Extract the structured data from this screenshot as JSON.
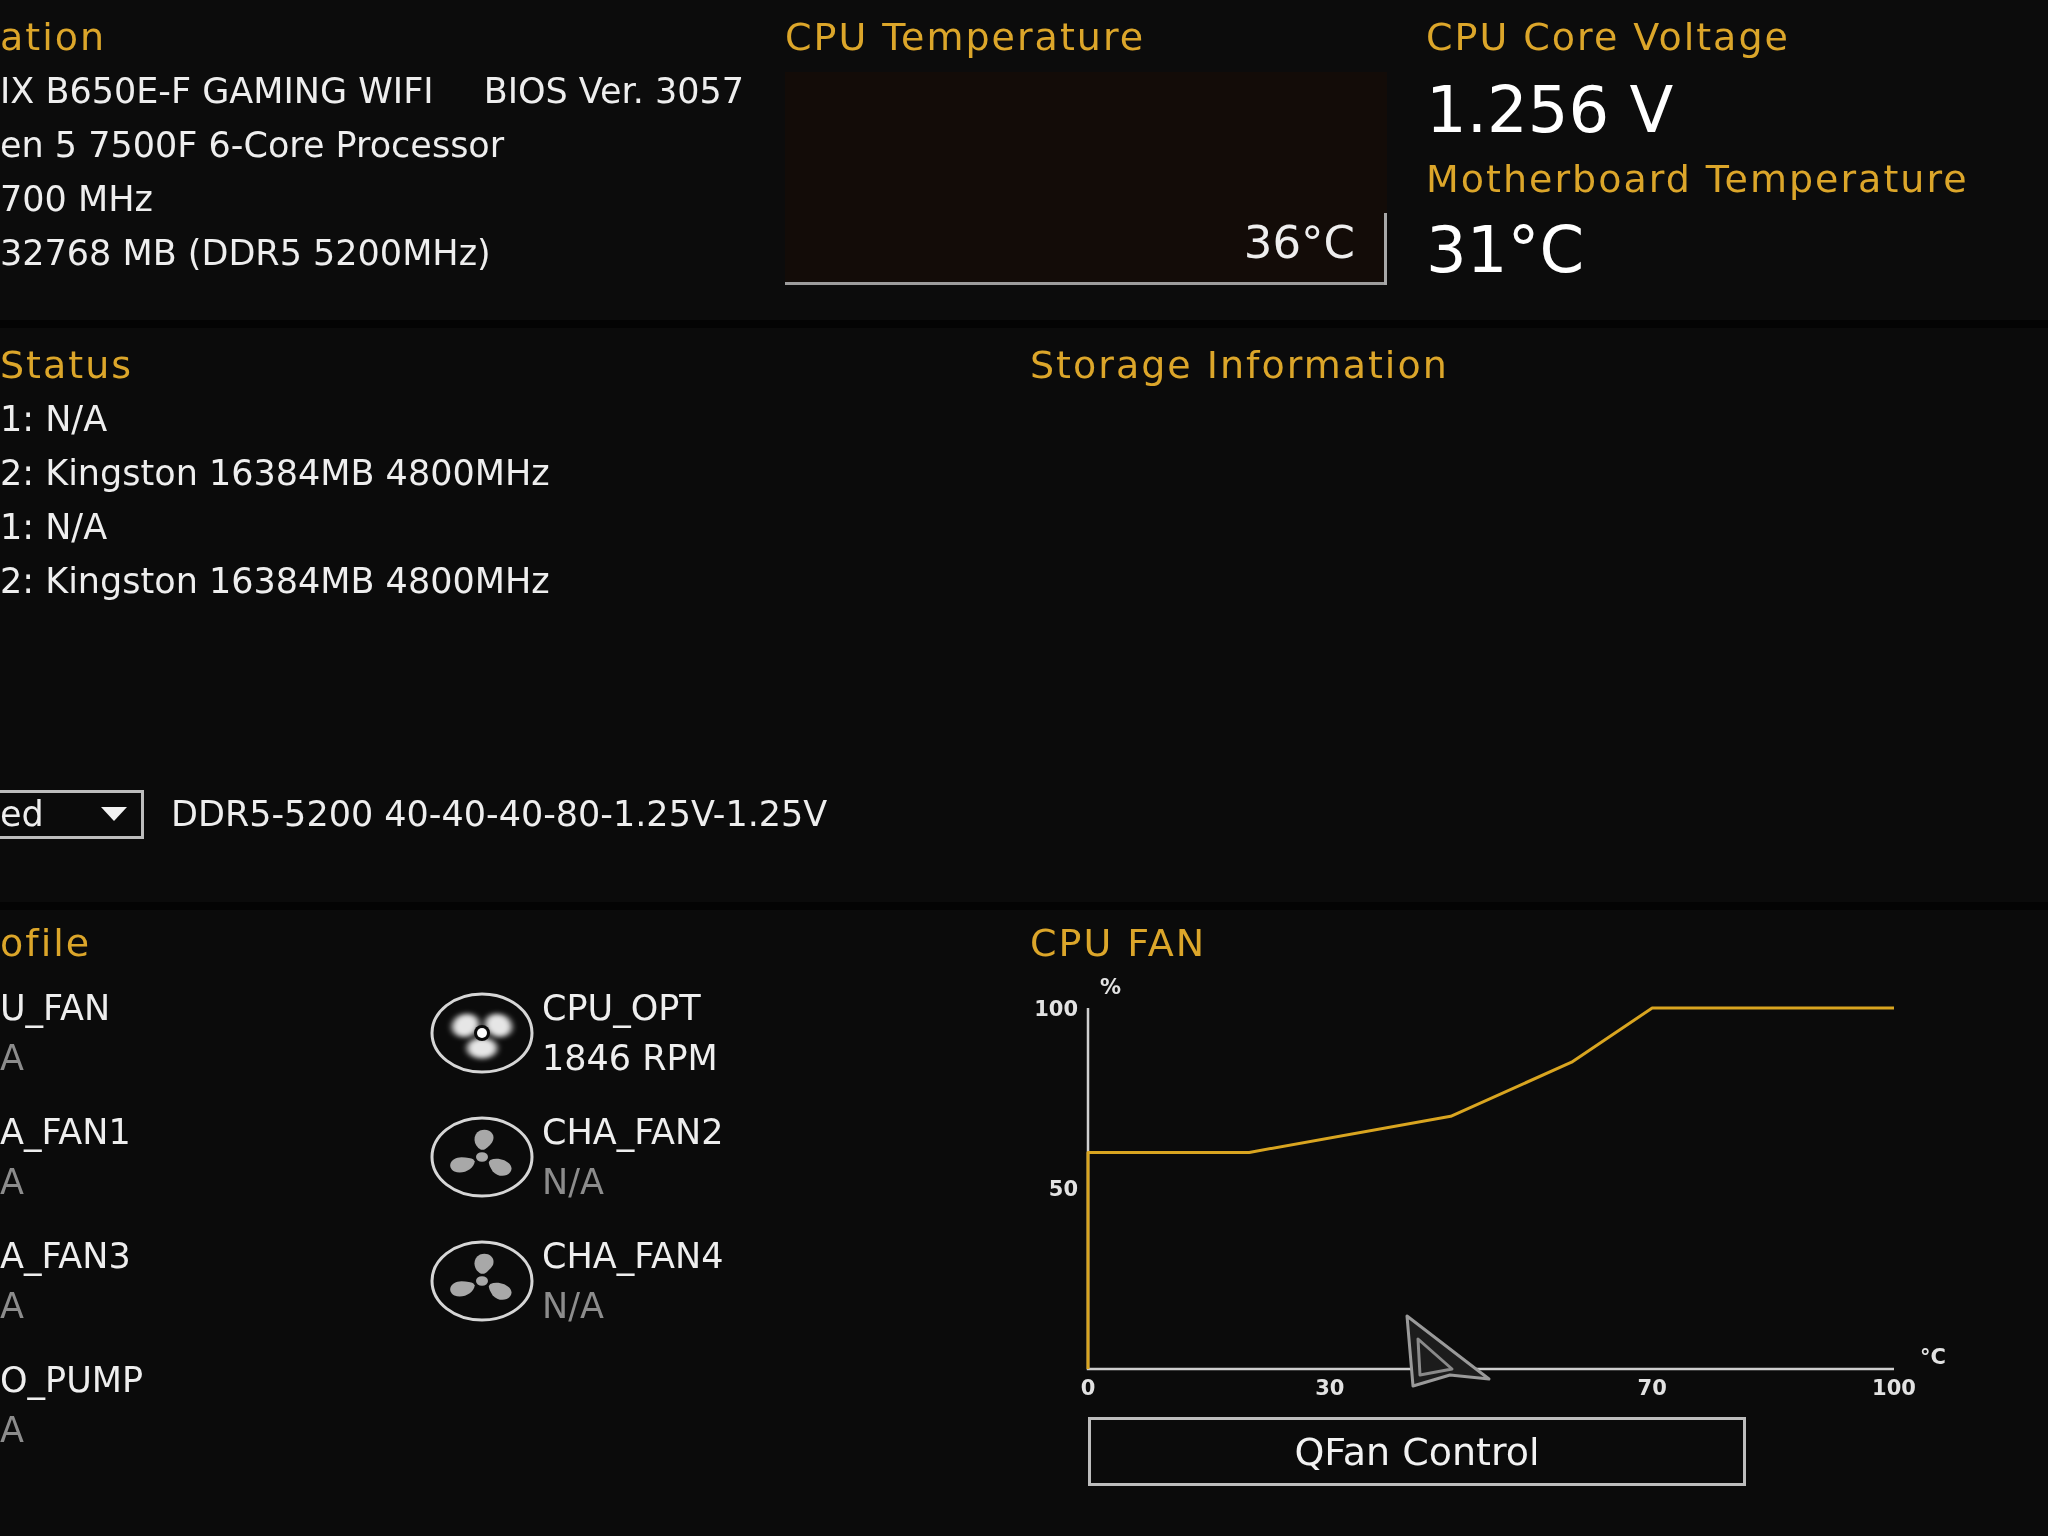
{
  "system_information": {
    "title": "ation",
    "board": "IX B650E-F GAMING WIFI",
    "bios_version": "BIOS Ver. 3057",
    "cpu": "en 5 7500F 6-Core Processor",
    "speed": "700 MHz",
    "memory": "32768 MB (DDR5 5200MHz)"
  },
  "cpu_temperature": {
    "title": "CPU Temperature",
    "reading": "36°C"
  },
  "cpu_core_voltage": {
    "title": "CPU Core Voltage",
    "value": "1.256 V"
  },
  "motherboard_temperature": {
    "title": "Motherboard Temperature",
    "value": "31°C"
  },
  "dram_status": {
    "title": "Status",
    "slots": [
      "1: N/A",
      "2: Kingston 16384MB 4800MHz",
      "1: N/A",
      "2: Kingston 16384MB 4800MHz"
    ]
  },
  "storage_information": {
    "title": "Storage Information"
  },
  "memory_profile": {
    "dropdown": {
      "value": "ed"
    },
    "description": "DDR5-5200 40-40-40-80-1.25V-1.25V"
  },
  "fan_profile": {
    "title": "ofile",
    "column_1": [
      {
        "name": "U_FAN",
        "reading": "A",
        "spinning": false
      },
      {
        "name": "A_FAN1",
        "reading": "A",
        "spinning": false
      },
      {
        "name": "A_FAN3",
        "reading": "A",
        "spinning": false
      },
      {
        "name": "O_PUMP",
        "reading": "A",
        "spinning": false
      }
    ],
    "column_2": [
      {
        "name": "CPU_OPT",
        "reading": "1846 RPM",
        "spinning": true
      },
      {
        "name": "CHA_FAN2",
        "reading": "N/A",
        "spinning": false
      },
      {
        "name": "CHA_FAN4",
        "reading": "N/A",
        "spinning": false
      }
    ]
  },
  "cpu_fan": {
    "title": "CPU FAN",
    "chart_data": {
      "type": "line",
      "xlabel": "°C",
      "ylabel": "%",
      "x": [
        0,
        0,
        20,
        45,
        60,
        70,
        100
      ],
      "values": [
        0,
        60,
        60,
        70,
        85,
        100,
        100
      ],
      "color": "#d9a520",
      "xlim": [
        0,
        100
      ],
      "ylim": [
        0,
        100
      ],
      "xticks": [
        0,
        30,
        70,
        100
      ],
      "yticks": [
        50,
        100
      ]
    },
    "button": "QFan Control"
  }
}
